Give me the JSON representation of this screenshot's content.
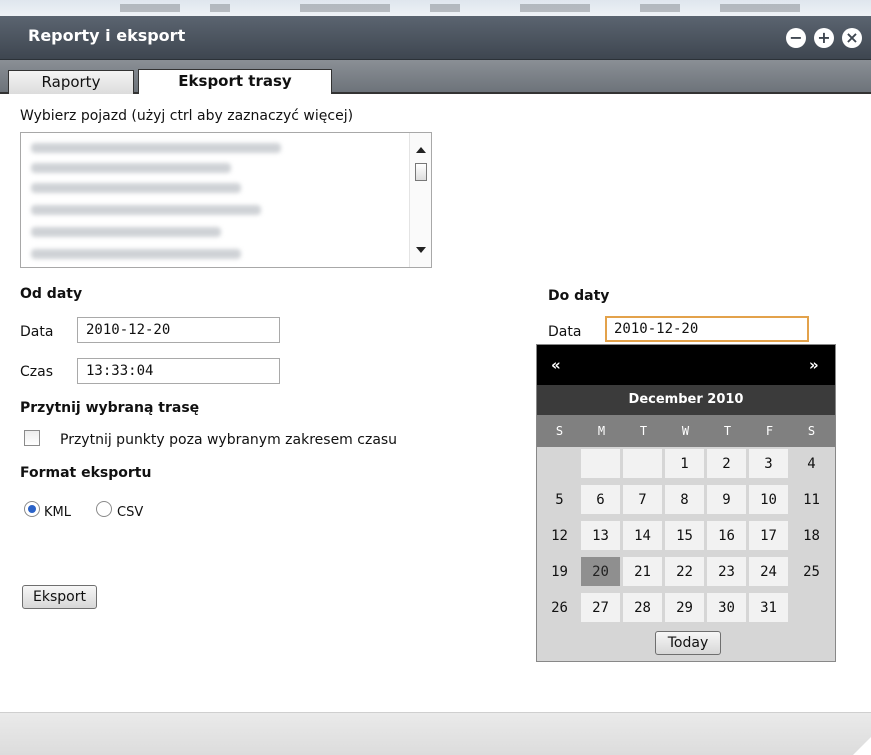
{
  "window": {
    "title": "Reporty i eksport",
    "controls": [
      "minimize-icon",
      "maximize-icon",
      "close-icon"
    ],
    "minimize_glyph": "−",
    "maximize_glyph": "+",
    "close_glyph": "×"
  },
  "tabs": [
    {
      "label": "Raporty",
      "active": false
    },
    {
      "label": "Eksport trasy",
      "active": true
    }
  ],
  "vehicle_select": {
    "label": "Wybierz pojazd (użyj ctrl aby zaznaczyć więcej)"
  },
  "from": {
    "heading": "Od daty",
    "date_label": "Data",
    "date_value": "2010-12-20",
    "time_label": "Czas",
    "time_value": "13:33:04"
  },
  "to": {
    "heading": "Do daty",
    "date_label": "Data",
    "date_value": "2010-12-20"
  },
  "trim": {
    "heading": "Przytnij wybraną trasę",
    "checkbox_label": "Przytnij punkty poza wybranym zakresem czasu",
    "checked": false
  },
  "format": {
    "heading": "Format eksportu",
    "options": [
      {
        "label": "KML",
        "checked": true
      },
      {
        "label": "CSV",
        "checked": false
      }
    ]
  },
  "export_button": "Eksport",
  "calendar": {
    "prev": "«",
    "next": "»",
    "month": "December 2010",
    "weekdays": [
      "S",
      "M",
      "T",
      "W",
      "T",
      "F",
      "S"
    ],
    "selected_day": 20,
    "days": [
      [
        "",
        "",
        "",
        "1",
        "2",
        "3",
        "4"
      ],
      [
        "5",
        "6",
        "7",
        "8",
        "9",
        "10",
        "11"
      ],
      [
        "12",
        "13",
        "14",
        "15",
        "16",
        "17",
        "18"
      ],
      [
        "19",
        "20",
        "21",
        "22",
        "23",
        "24",
        "25"
      ],
      [
        "26",
        "27",
        "28",
        "29",
        "30",
        "31",
        ""
      ]
    ],
    "today_button": "Today"
  },
  "colors": {
    "titlebar": "#4a525c",
    "focus_border": "#e3a24b",
    "radio_accent": "#2a62c8"
  }
}
